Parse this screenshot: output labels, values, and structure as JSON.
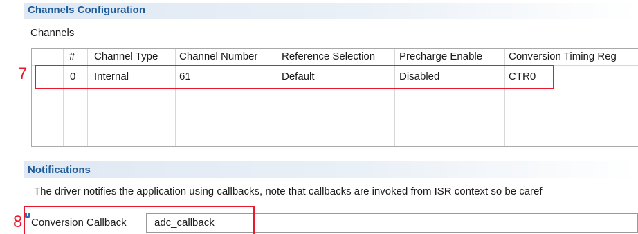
{
  "channels_section": {
    "title": "Channels Configuration",
    "table_label": "Channels",
    "columns": [
      "#",
      "Channel Type",
      "Channel Number",
      "Reference Selection",
      "Precharge Enable",
      "Conversion Timing Reg"
    ],
    "rows": [
      [
        "0",
        "Internal",
        "61",
        "Default",
        "Disabled",
        "CTR0"
      ]
    ]
  },
  "notifications_section": {
    "title": "Notifications",
    "description": "The driver notifies the application using callbacks, note that callbacks are invoked from ISR context so be caref",
    "callback_label": "Conversion Callback",
    "callback_value": "adc_callback",
    "info_icon": "info-icon"
  },
  "annotations": {
    "marker_7": "7",
    "marker_8": "8",
    "highlight_color": "#e8192c"
  }
}
